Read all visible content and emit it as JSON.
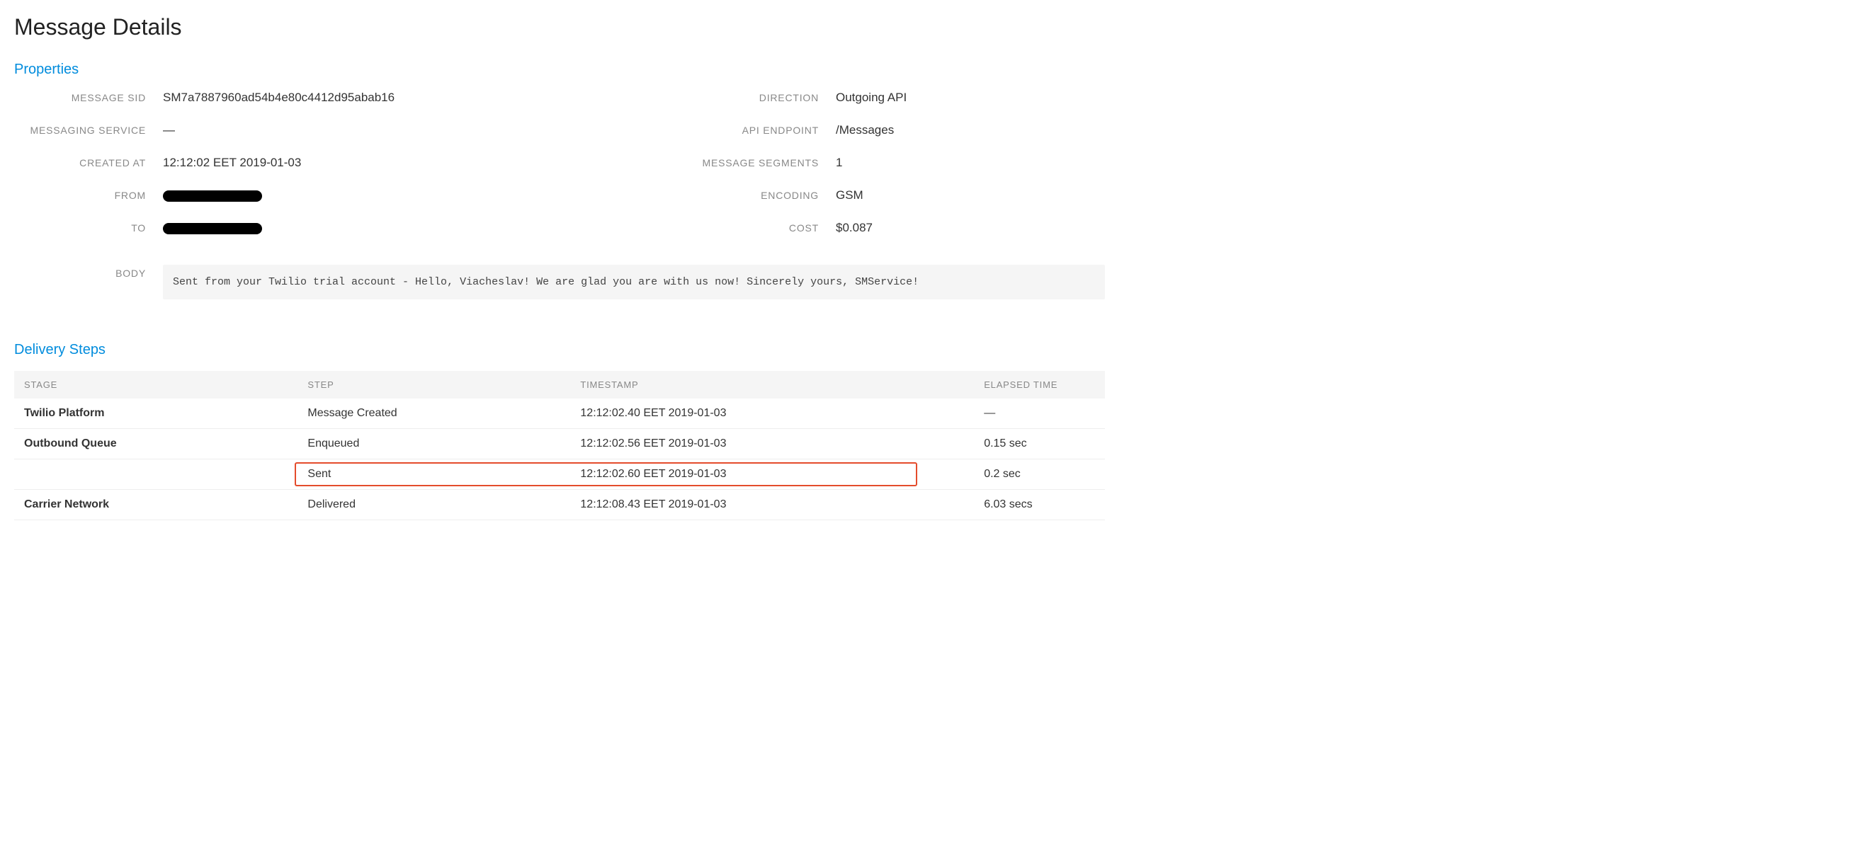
{
  "page": {
    "title": "Message Details"
  },
  "sections": {
    "properties": "Properties",
    "delivery": "Delivery Steps"
  },
  "labels": {
    "message_sid": "MESSAGE SID",
    "messaging_service": "MESSAGING SERVICE",
    "created_at": "CREATED AT",
    "from": "FROM",
    "to": "TO",
    "body": "BODY",
    "direction": "DIRECTION",
    "api_endpoint": "API ENDPOINT",
    "message_segments": "MESSAGE SEGMENTS",
    "encoding": "ENCODING",
    "cost": "COST"
  },
  "values": {
    "message_sid": "SM7a7887960ad54b4e80c4412d95abab16",
    "messaging_service": "—",
    "created_at": "12:12:02 EET 2019-01-03",
    "from": "[redacted]",
    "to": "[redacted]",
    "body": "Sent from your Twilio trial account - Hello, Viacheslav! We are glad you are with us now! Sincerely yours, SMService!",
    "direction": "Outgoing API",
    "api_endpoint": "/Messages",
    "message_segments": "1",
    "encoding": "GSM",
    "cost": "$0.087"
  },
  "delivery_table": {
    "headers": {
      "stage": "STAGE",
      "step": "STEP",
      "timestamp": "TIMESTAMP",
      "elapsed": "ELAPSED TIME"
    },
    "rows": [
      {
        "stage": "Twilio Platform",
        "step": "Message Created",
        "timestamp": "12:12:02.40 EET 2019-01-03",
        "elapsed": "—",
        "highlight": false
      },
      {
        "stage": "Outbound Queue",
        "step": "Enqueued",
        "timestamp": "12:12:02.56 EET 2019-01-03",
        "elapsed": "0.15 sec",
        "highlight": false
      },
      {
        "stage": "",
        "step": "Sent",
        "timestamp": "12:12:02.60 EET 2019-01-03",
        "elapsed": "0.2 sec",
        "highlight": true
      },
      {
        "stage": "Carrier Network",
        "step": "Delivered",
        "timestamp": "12:12:08.43 EET 2019-01-03",
        "elapsed": "6.03 secs",
        "highlight": false
      }
    ]
  }
}
